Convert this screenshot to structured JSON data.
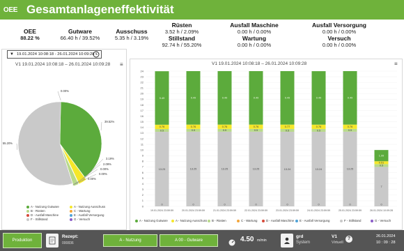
{
  "header": {
    "logo_text": "OEE",
    "title": "Gesamtanlageneffektivität",
    "bar_color": "#6fb23b"
  },
  "kpis": [
    {
      "label": "OEE",
      "value": "88.22 %",
      "bold": true
    },
    {
      "label": "Gutware",
      "value": "66.40 h / 39.52%"
    },
    {
      "label": "Ausschuss",
      "value": "5.35 h / 3.19%"
    },
    {
      "label": "Rüsten",
      "value": "3.52 h / 2.09%"
    },
    {
      "label": "Stillstand",
      "value": "92.74 h / 55.20%"
    },
    {
      "label": "Ausfall Maschine",
      "value": "0.00 h / 0.00%"
    },
    {
      "label": "Wartung",
      "value": "0.00 h / 0.00%"
    },
    {
      "label": "Ausfall Versorgung",
      "value": "0.00 h / 0.00%"
    },
    {
      "label": "Versuch",
      "value": "0.00 h / 0.00%"
    }
  ],
  "date_range": {
    "value": "19.01.2024 10:08:18 - 26.01.2024 10:09:28",
    "icon": "clock-icon"
  },
  "left_chart": {
    "subtitle": "V1 19.01.2024 10:08:18 – 26.01.2024 10:09:28"
  },
  "right_chart": {
    "subtitle": "V1 19.01.2024 10:08:18 – 26.01.2024 10:09:28"
  },
  "legend_left": [
    {
      "code": "A",
      "label": "A - Nutzung Gutware",
      "color": "#5cab3c"
    },
    {
      "code": "A2",
      "label": "A - Nutzung Ausschuss",
      "color": "#f5e72a"
    },
    {
      "code": "B",
      "label": "B - Rüsten",
      "color": "#b8d98a"
    },
    {
      "code": "C",
      "label": "C - Wartung",
      "color": "#f4a63a"
    },
    {
      "code": "D",
      "label": "D - Ausfall Maschine",
      "color": "#d64a3a"
    },
    {
      "code": "E",
      "label": "E - Ausfall Versorgung",
      "color": "#4fa3d8"
    },
    {
      "code": "F",
      "label": "F - Stillstand",
      "color": "#c9c9c9"
    },
    {
      "code": "G",
      "label": "G - Versuch",
      "color": "#8a5cc8"
    }
  ],
  "legend_right": [
    {
      "label": "A - Nutzung Gutware",
      "color": "#5cab3c"
    },
    {
      "label": "A - Nutzung Ausschuss",
      "color": "#f5e72a"
    },
    {
      "label": "B - Rüsten",
      "color": "#b8d98a"
    },
    {
      "label": "C - Wartung",
      "color": "#f4a63a"
    },
    {
      "label": "D - Ausfall Maschine",
      "color": "#d64a3a"
    },
    {
      "label": "E - Ausfall Versorgung",
      "color": "#4fa3d8"
    },
    {
      "label": "F - Stillstand",
      "color": "#c9c9c9"
    },
    {
      "label": "G - Versuch",
      "color": "#8a5cc8"
    }
  ],
  "chart_data": [
    {
      "type": "pie",
      "slices": [
        {
          "label": "A - Nutzung Gutware",
          "value": 39.52,
          "text": "39.52%",
          "color": "#5cab3c"
        },
        {
          "label": "A - Nutzung Ausschuss",
          "value": 3.19,
          "text": "3.19%",
          "color": "#f5e72a"
        },
        {
          "label": "B - Rüsten",
          "value": 2.09,
          "text": "2.09%",
          "color": "#b8d98a"
        },
        {
          "label": "C - Wartung",
          "value": 0.0,
          "text": "0.00%",
          "color": "#f4a63a"
        },
        {
          "label": "D - Ausfall Maschine",
          "value": 0.0,
          "text": "0.00%",
          "color": "#d64a3a"
        },
        {
          "label": "E - Ausfall Versorgung",
          "value": 0.0,
          "text": "0.00%",
          "color": "#4fa3d8"
        },
        {
          "label": "F - Stillstand",
          "value": 55.2,
          "text": "55.20%",
          "color": "#c9c9c9"
        },
        {
          "label": "G - Versuch",
          "value": 0.0,
          "text": "0.00%",
          "color": "#8a5cc8"
        }
      ]
    },
    {
      "type": "bar",
      "stacked": true,
      "categories": [
        "19.01.2024 23:59:59",
        "20.01.2024 23:59:59",
        "21.01.2024 23:59:59",
        "22.01.2024 23:59:59",
        "23.01.2024 23:59:59",
        "24.01.2024 23:59:59",
        "25.01.2024 23:59:59",
        "26.01.2024 10:09:28"
      ],
      "ylim": [
        0,
        24
      ],
      "yticks": [
        "0",
        "1",
        "2",
        "3",
        "4",
        "5",
        "6",
        "7",
        "8",
        "9",
        "10",
        "11",
        "12",
        "13",
        "14",
        "15",
        "16",
        "17",
        "18",
        "19",
        "20",
        "21",
        "22",
        "23",
        "24"
      ],
      "series": [
        {
          "key": "F",
          "color": "#c9c9c9",
          "values": [
            13.23,
            13.25,
            13.25,
            13.25,
            13.24,
            13.24,
            13.25,
            7.0
          ],
          "labels": [
            "13.23",
            "13.25",
            "13.25",
            "13.25",
            "13.24",
            "13.24",
            "13.25",
            "7"
          ]
        },
        {
          "key": "B",
          "color": "#b8d98a",
          "values": [
            0.5,
            0.5,
            0.5,
            0.5,
            0.5,
            0.5,
            0.5,
            0.5
          ],
          "labels": [
            "0.5",
            "0.5",
            "0.5",
            "0.5",
            "0.5",
            "0.5",
            "0.5",
            "0.5"
          ]
        },
        {
          "key": "A2",
          "color": "#f5e72a",
          "values": [
            0.76,
            0.76,
            0.76,
            0.76,
            0.77,
            0.76,
            0.76,
            0.51
          ],
          "labels": [
            "0.76",
            "0.76",
            "0.76",
            "0.76",
            "0.77",
            "0.76",
            "0.76",
            "0.51"
          ]
        },
        {
          "key": "A",
          "color": "#5cab3c",
          "values": [
            9.49,
            9.49,
            9.49,
            9.49,
            9.49,
            9.49,
            9.49,
            1.99
          ],
          "labels": [
            "9.49",
            "9.49",
            "9.49",
            "9.49",
            "9.49",
            "9.49",
            "9.49",
            "1.99"
          ]
        }
      ],
      "zero_labels": [
        "0",
        "0",
        "0",
        "0",
        "0",
        "0",
        "0",
        "0"
      ]
    }
  ],
  "footer": {
    "production_label": "Produktion",
    "recipe_label": "Rezept:",
    "recipe_value": "000836",
    "mode_label": "A - Nutzung",
    "mode2_label": "A 00 - Gutware",
    "speed_value": "4.50",
    "speed_unit": "m/min",
    "user_name": "grd",
    "user_role": "System",
    "line_name": "V1",
    "line_type": "Virtuell",
    "date": "26.01.2024",
    "time": "10 : 09 : 28"
  }
}
